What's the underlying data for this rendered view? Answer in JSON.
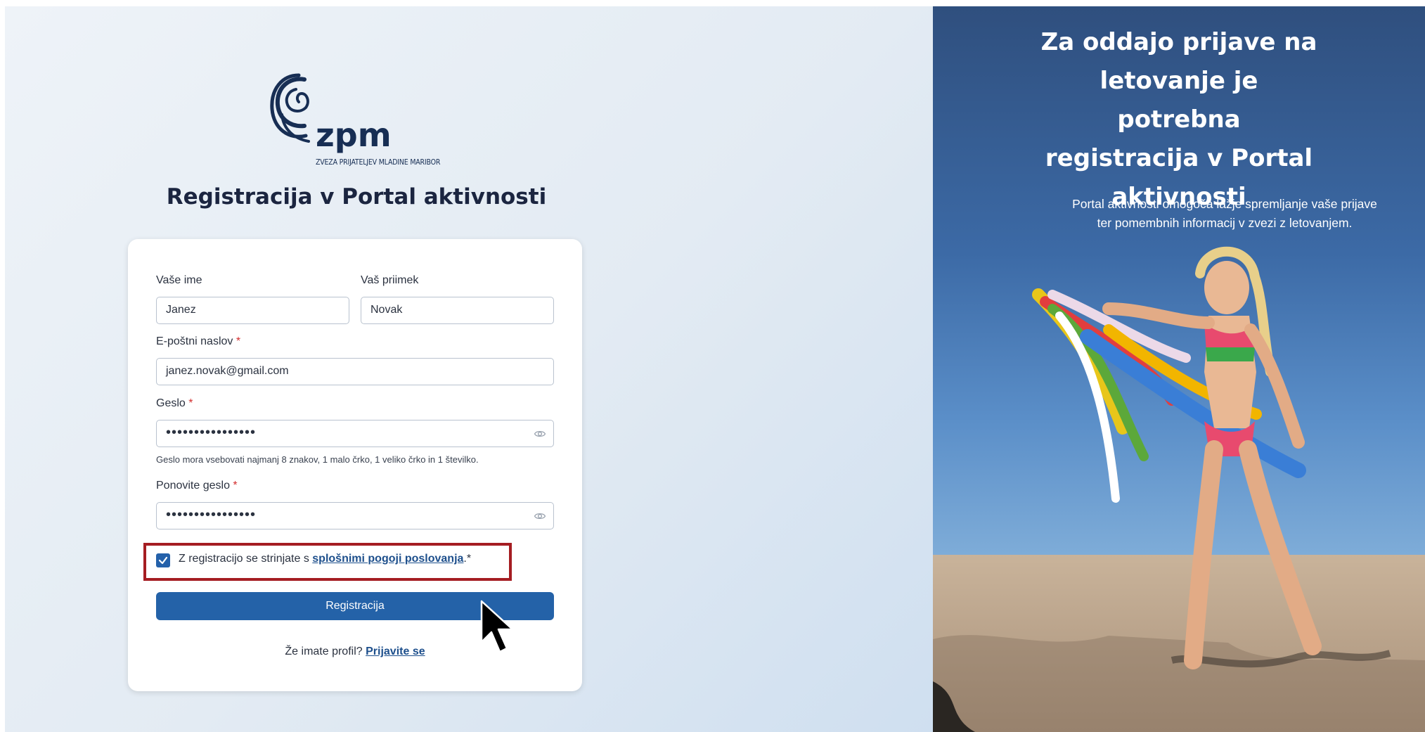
{
  "logo": {
    "brand": "zpm",
    "subtitle": "ZVEZA PRIJATELJEV MLADINE MARIBOR"
  },
  "form": {
    "title": "Registracija v Portal aktivnosti",
    "first_name": {
      "label": "Vaše ime",
      "value": "Janez"
    },
    "last_name": {
      "label": "Vaš priimek",
      "value": "Novak"
    },
    "email": {
      "label": "E-poštni naslov",
      "required_mark": "*",
      "value": "janez.novak@gmail.com"
    },
    "password": {
      "label": "Geslo",
      "required_mark": "*",
      "value": "••••••••••••••••",
      "hint": "Geslo mora vsebovati najmanj 8 znakov, 1 malo črko, 1 veliko črko in 1 številko."
    },
    "password_repeat": {
      "label": "Ponovite geslo",
      "required_mark": "*",
      "value": "••••••••••••••••"
    },
    "consent": {
      "checked": true,
      "text_before": "Z registracijo se strinjate s ",
      "link_text": "splošnimi pogoji poslovanja",
      "text_after": ".*"
    },
    "submit_label": "Registracija",
    "login_prompt": "Že imate profil?",
    "login_link": "Prijavite se"
  },
  "right_panel": {
    "title": "Za oddajo prijave na letovanje je potrebna registracija v Portal aktivnosti",
    "body": "Portal aktivnosti omogoča lažje spremljanje vaše prijave ter pomembnih informacij v zvezi z letovanjem."
  },
  "colors": {
    "primary": "#2462a8",
    "brand_navy": "#172e54",
    "highlight": "#a51d22",
    "required": "#d32f2f"
  },
  "icons": [
    "eye-icon",
    "checkmark-icon",
    "cursor-arrow-icon",
    "zpm-logo-swirl-icon"
  ]
}
